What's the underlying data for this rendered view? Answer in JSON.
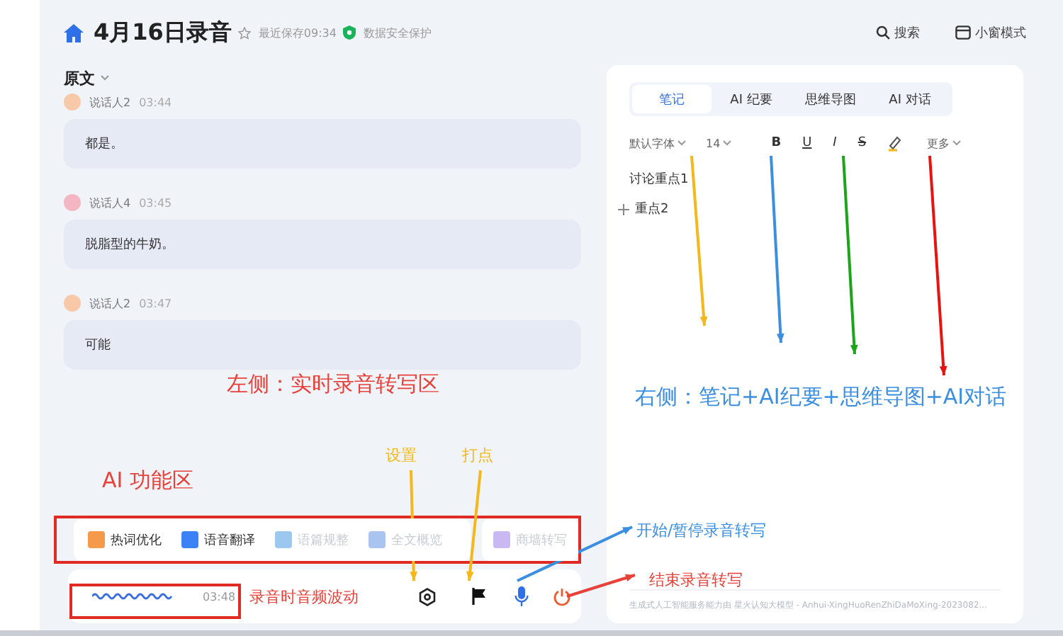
{
  "header": {
    "title": "4月16日录音",
    "saved": "最近保存09:34",
    "security": "数据安全保护",
    "actions": [
      "搜索",
      "小窗模式"
    ]
  },
  "transcript": {
    "heading": "原文",
    "messages": [
      {
        "speaker": "说话人2",
        "time": "03:44",
        "text": "都是。",
        "color": "#f8c9a8"
      },
      {
        "speaker": "说话人4",
        "time": "03:45",
        "text": "脱脂型的牛奶。",
        "color": "#f4b6c2"
      },
      {
        "speaker": "说话人2",
        "time": "03:47",
        "text": "可能",
        "color": "#f8c9a8"
      }
    ]
  },
  "ai_tools": [
    {
      "label": "热词优化",
      "disabled": false,
      "color": "#f59a4a"
    },
    {
      "label": "语音翻译",
      "disabled": false,
      "color": "#3b82f6"
    },
    {
      "label": "语篇规整",
      "disabled": true,
      "color": "#9cc8f0"
    },
    {
      "label": "全文概览",
      "disabled": true,
      "color": "#a9c4ee"
    },
    {
      "label": "商墙转写",
      "disabled": true,
      "color": "#c9b8f2"
    }
  ],
  "recorder": {
    "elapsed": "03:48",
    "recording": true
  },
  "notes": {
    "tabs": [
      {
        "label": "笔记",
        "selected": true
      },
      {
        "label": "AI 纪要",
        "selected": false
      },
      {
        "label": "思维导图",
        "selected": false
      },
      {
        "label": "AI 对话",
        "selected": false
      }
    ],
    "toolbar": {
      "font": "默认字体",
      "size": "14",
      "bold": "B",
      "underline": "U",
      "italic": "I",
      "strike": "S",
      "more": "更多"
    },
    "lines": [
      {
        "text": "讨论重点1",
        "kind": "text"
      },
      {
        "text": "重点2",
        "kind": "add"
      }
    ],
    "footer": "生成式人工智能服务能力由 星火认知大模型 - Anhui-XingHuoRenZhiDaMoXing-2023082..."
  },
  "annotations": [
    {
      "text": "左侧：实时录音转写区",
      "color": "#e8413a"
    },
    {
      "text": "右侧：笔记+AI纪要+思维导图+AI对话",
      "color": "#3b8fe0"
    },
    {
      "text": "AI 功能区",
      "color": "#e8413a"
    },
    {
      "text": "设置",
      "color": "#f5b81c"
    },
    {
      "text": "打点",
      "color": "#f5b81c"
    },
    {
      "text": "开始/暂停录音转写",
      "color": "#3b8fe0"
    },
    {
      "text": "结束录音转写",
      "color": "#e8413a"
    },
    {
      "text": "录音时音频波动",
      "color": "#e8413a"
    }
  ]
}
